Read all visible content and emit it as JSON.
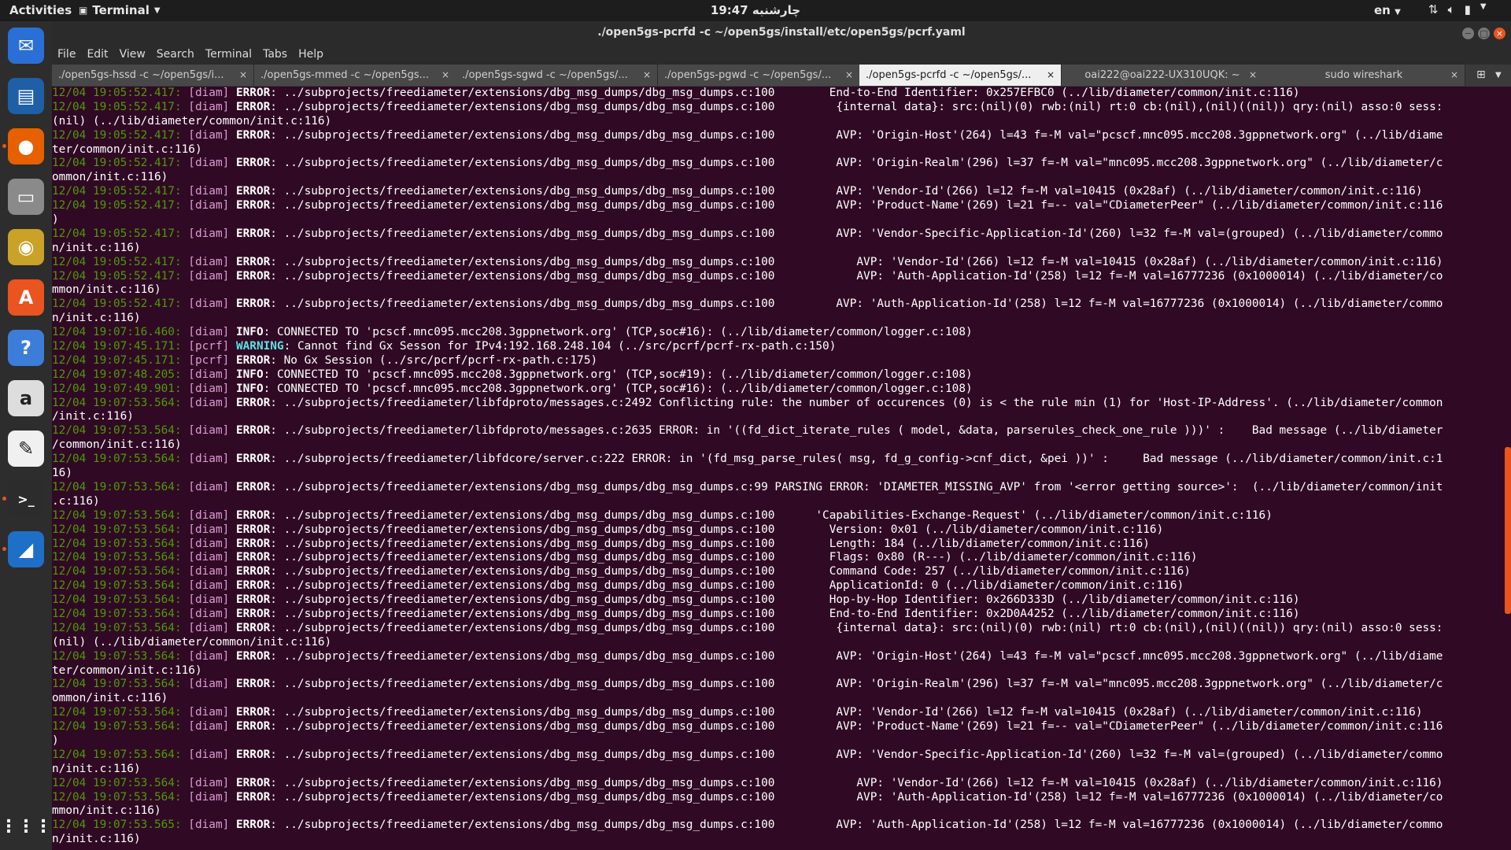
{
  "topbar": {
    "activities": "Activities",
    "app_name": "Terminal",
    "clock": "19:47 چارشنبه",
    "lang": "en"
  },
  "window": {
    "title": "./open5gs-pcrfd -c ~/open5gs/install/etc/open5gs/pcrf.yaml"
  },
  "menu": [
    "File",
    "Edit",
    "View",
    "Search",
    "Terminal",
    "Tabs",
    "Help"
  ],
  "tabs": [
    {
      "label": "./open5gs-hssd -c ~/open5gs/i...",
      "active": false
    },
    {
      "label": "./open5gs-mmed -c ~/open5gs...",
      "active": false
    },
    {
      "label": "./open5gs-sgwd -c ~/open5gs/...",
      "active": false
    },
    {
      "label": "./open5gs-pgwd -c ~/open5gs/...",
      "active": false
    },
    {
      "label": "./open5gs-pcrfd -c ~/open5gs/...",
      "active": true
    },
    {
      "label": "oai222@oai222-UX310UQK: ~",
      "active": false
    },
    {
      "label": "sudo wireshark",
      "active": false
    }
  ],
  "lines": [
    {
      "ts": "12/04 19:05:52.417:",
      "mod": "[diam]",
      "lvl": "ERROR",
      "msg": "../subprojects/freediameter/extensions/dbg_msg_dumps/dbg_msg_dumps.c:100        End-to-End Identifier: 0x257EFBC0 (../lib/diameter/common/init.c:116)"
    },
    {
      "ts": "12/04 19:05:52.417:",
      "mod": "[diam]",
      "lvl": "ERROR",
      "msg": "../subprojects/freediameter/extensions/dbg_msg_dumps/dbg_msg_dumps.c:100         {internal data}: src:(nil)(0) rwb:(nil) rt:0 cb:(nil),(nil)((nil)) qry:(nil) asso:0 sess:"
    },
    {
      "cont": "(nil) (../lib/diameter/common/init.c:116)"
    },
    {
      "ts": "12/04 19:05:52.417:",
      "mod": "[diam]",
      "lvl": "ERROR",
      "msg": "../subprojects/freediameter/extensions/dbg_msg_dumps/dbg_msg_dumps.c:100         AVP: 'Origin-Host'(264) l=43 f=-M val=\"pcscf.mnc095.mcc208.3gppnetwork.org\" (../lib/diame"
    },
    {
      "cont": "ter/common/init.c:116)"
    },
    {
      "ts": "12/04 19:05:52.417:",
      "mod": "[diam]",
      "lvl": "ERROR",
      "msg": "../subprojects/freediameter/extensions/dbg_msg_dumps/dbg_msg_dumps.c:100         AVP: 'Origin-Realm'(296) l=37 f=-M val=\"mnc095.mcc208.3gppnetwork.org\" (../lib/diameter/c"
    },
    {
      "cont": "ommon/init.c:116)"
    },
    {
      "ts": "12/04 19:05:52.417:",
      "mod": "[diam]",
      "lvl": "ERROR",
      "msg": "../subprojects/freediameter/extensions/dbg_msg_dumps/dbg_msg_dumps.c:100         AVP: 'Vendor-Id'(266) l=12 f=-M val=10415 (0x28af) (../lib/diameter/common/init.c:116)"
    },
    {
      "ts": "12/04 19:05:52.417:",
      "mod": "[diam]",
      "lvl": "ERROR",
      "msg": "../subprojects/freediameter/extensions/dbg_msg_dumps/dbg_msg_dumps.c:100         AVP: 'Product-Name'(269) l=21 f=-- val=\"CDiameterPeer\" (../lib/diameter/common/init.c:116"
    },
    {
      "cont": ")"
    },
    {
      "ts": "12/04 19:05:52.417:",
      "mod": "[diam]",
      "lvl": "ERROR",
      "msg": "../subprojects/freediameter/extensions/dbg_msg_dumps/dbg_msg_dumps.c:100         AVP: 'Vendor-Specific-Application-Id'(260) l=32 f=-M val=(grouped) (../lib/diameter/commo"
    },
    {
      "cont": "n/init.c:116)"
    },
    {
      "ts": "12/04 19:05:52.417:",
      "mod": "[diam]",
      "lvl": "ERROR",
      "msg": "../subprojects/freediameter/extensions/dbg_msg_dumps/dbg_msg_dumps.c:100            AVP: 'Vendor-Id'(266) l=12 f=-M val=10415 (0x28af) (../lib/diameter/common/init.c:116)"
    },
    {
      "ts": "12/04 19:05:52.417:",
      "mod": "[diam]",
      "lvl": "ERROR",
      "msg": "../subprojects/freediameter/extensions/dbg_msg_dumps/dbg_msg_dumps.c:100            AVP: 'Auth-Application-Id'(258) l=12 f=-M val=16777236 (0x1000014) (../lib/diameter/co"
    },
    {
      "cont": "mmon/init.c:116)"
    },
    {
      "ts": "12/04 19:05:52.417:",
      "mod": "[diam]",
      "lvl": "ERROR",
      "msg": "../subprojects/freediameter/extensions/dbg_msg_dumps/dbg_msg_dumps.c:100         AVP: 'Auth-Application-Id'(258) l=12 f=-M val=16777236 (0x1000014) (../lib/diameter/commo"
    },
    {
      "cont": "n/init.c:116)"
    },
    {
      "ts": "12/04 19:07:16.460:",
      "mod": "[diam]",
      "lvl": "INFO",
      "msg": "CONNECTED TO 'pcscf.mnc095.mcc208.3gppnetwork.org' (TCP,soc#16): (../lib/diameter/common/logger.c:108)"
    },
    {
      "ts": "12/04 19:07:45.171:",
      "mod": "[pcrf]",
      "lvl": "WARNING",
      "msg": "Cannot find Gx Sesson for IPv4:192.168.248.104 (../src/pcrf/pcrf-rx-path.c:150)"
    },
    {
      "ts": "12/04 19:07:45.171:",
      "mod": "[pcrf]",
      "lvl": "ERROR",
      "msg": "No Gx Session (../src/pcrf/pcrf-rx-path.c:175)"
    },
    {
      "ts": "12/04 19:07:48.205:",
      "mod": "[diam]",
      "lvl": "INFO",
      "msg": "CONNECTED TO 'pcscf.mnc095.mcc208.3gppnetwork.org' (TCP,soc#19): (../lib/diameter/common/logger.c:108)"
    },
    {
      "ts": "12/04 19:07:49.901:",
      "mod": "[diam]",
      "lvl": "INFO",
      "msg": "CONNECTED TO 'pcscf.mnc095.mcc208.3gppnetwork.org' (TCP,soc#16): (../lib/diameter/common/logger.c:108)"
    },
    {
      "ts": "12/04 19:07:53.564:",
      "mod": "[diam]",
      "lvl": "ERROR",
      "msg": "../subprojects/freediameter/libfdproto/messages.c:2492 Conflicting rule: the number of occurences (0) is < the rule min (1) for 'Host-IP-Address'. (../lib/diameter/common"
    },
    {
      "cont": "/init.c:116)"
    },
    {
      "ts": "12/04 19:07:53.564:",
      "mod": "[diam]",
      "lvl": "ERROR",
      "msg": "../subprojects/freediameter/libfdproto/messages.c:2635 ERROR: in '((fd_dict_iterate_rules ( model, &data, parserules_check_one_rule )))' :    Bad message (../lib/diameter"
    },
    {
      "cont": "/common/init.c:116)"
    },
    {
      "ts": "12/04 19:07:53.564:",
      "mod": "[diam]",
      "lvl": "ERROR",
      "msg": "../subprojects/freediameter/libfdcore/server.c:222 ERROR: in '(fd_msg_parse_rules( msg, fd_g_config->cnf_dict, &pei ))' :     Bad message (../lib/diameter/common/init.c:1"
    },
    {
      "cont": "16)"
    },
    {
      "ts": "12/04 19:07:53.564:",
      "mod": "[diam]",
      "lvl": "ERROR",
      "msg": "../subprojects/freediameter/extensions/dbg_msg_dumps/dbg_msg_dumps.c:99 PARSING ERROR: 'DIAMETER_MISSING_AVP' from '<error getting source>':  (../lib/diameter/common/init"
    },
    {
      "cont": ".c:116)"
    },
    {
      "ts": "12/04 19:07:53.564:",
      "mod": "[diam]",
      "lvl": "ERROR",
      "msg": "../subprojects/freediameter/extensions/dbg_msg_dumps/dbg_msg_dumps.c:100      'Capabilities-Exchange-Request' (../lib/diameter/common/init.c:116)"
    },
    {
      "ts": "12/04 19:07:53.564:",
      "mod": "[diam]",
      "lvl": "ERROR",
      "msg": "../subprojects/freediameter/extensions/dbg_msg_dumps/dbg_msg_dumps.c:100        Version: 0x01 (../lib/diameter/common/init.c:116)"
    },
    {
      "ts": "12/04 19:07:53.564:",
      "mod": "[diam]",
      "lvl": "ERROR",
      "msg": "../subprojects/freediameter/extensions/dbg_msg_dumps/dbg_msg_dumps.c:100        Length: 184 (../lib/diameter/common/init.c:116)"
    },
    {
      "ts": "12/04 19:07:53.564:",
      "mod": "[diam]",
      "lvl": "ERROR",
      "msg": "../subprojects/freediameter/extensions/dbg_msg_dumps/dbg_msg_dumps.c:100        Flags: 0x80 (R---) (../lib/diameter/common/init.c:116)"
    },
    {
      "ts": "12/04 19:07:53.564:",
      "mod": "[diam]",
      "lvl": "ERROR",
      "msg": "../subprojects/freediameter/extensions/dbg_msg_dumps/dbg_msg_dumps.c:100        Command Code: 257 (../lib/diameter/common/init.c:116)"
    },
    {
      "ts": "12/04 19:07:53.564:",
      "mod": "[diam]",
      "lvl": "ERROR",
      "msg": "../subprojects/freediameter/extensions/dbg_msg_dumps/dbg_msg_dumps.c:100        ApplicationId: 0 (../lib/diameter/common/init.c:116)"
    },
    {
      "ts": "12/04 19:07:53.564:",
      "mod": "[diam]",
      "lvl": "ERROR",
      "msg": "../subprojects/freediameter/extensions/dbg_msg_dumps/dbg_msg_dumps.c:100        Hop-by-Hop Identifier: 0x266D333D (../lib/diameter/common/init.c:116)"
    },
    {
      "ts": "12/04 19:07:53.564:",
      "mod": "[diam]",
      "lvl": "ERROR",
      "msg": "../subprojects/freediameter/extensions/dbg_msg_dumps/dbg_msg_dumps.c:100        End-to-End Identifier: 0x2D0A4252 (../lib/diameter/common/init.c:116)"
    },
    {
      "ts": "12/04 19:07:53.564:",
      "mod": "[diam]",
      "lvl": "ERROR",
      "msg": "../subprojects/freediameter/extensions/dbg_msg_dumps/dbg_msg_dumps.c:100         {internal data}: src:(nil)(0) rwb:(nil) rt:0 cb:(nil),(nil)((nil)) qry:(nil) asso:0 sess:"
    },
    {
      "cont": "(nil) (../lib/diameter/common/init.c:116)"
    },
    {
      "ts": "12/04 19:07:53.564:",
      "mod": "[diam]",
      "lvl": "ERROR",
      "msg": "../subprojects/freediameter/extensions/dbg_msg_dumps/dbg_msg_dumps.c:100         AVP: 'Origin-Host'(264) l=43 f=-M val=\"pcscf.mnc095.mcc208.3gppnetwork.org\" (../lib/diame"
    },
    {
      "cont": "ter/common/init.c:116)"
    },
    {
      "ts": "12/04 19:07:53.564:",
      "mod": "[diam]",
      "lvl": "ERROR",
      "msg": "../subprojects/freediameter/extensions/dbg_msg_dumps/dbg_msg_dumps.c:100         AVP: 'Origin-Realm'(296) l=37 f=-M val=\"mnc095.mcc208.3gppnetwork.org\" (../lib/diameter/c"
    },
    {
      "cont": "ommon/init.c:116)"
    },
    {
      "ts": "12/04 19:07:53.564:",
      "mod": "[diam]",
      "lvl": "ERROR",
      "msg": "../subprojects/freediameter/extensions/dbg_msg_dumps/dbg_msg_dumps.c:100         AVP: 'Vendor-Id'(266) l=12 f=-M val=10415 (0x28af) (../lib/diameter/common/init.c:116)"
    },
    {
      "ts": "12/04 19:07:53.564:",
      "mod": "[diam]",
      "lvl": "ERROR",
      "msg": "../subprojects/freediameter/extensions/dbg_msg_dumps/dbg_msg_dumps.c:100         AVP: 'Product-Name'(269) l=21 f=-- val=\"CDiameterPeer\" (../lib/diameter/common/init.c:116"
    },
    {
      "cont": ")"
    },
    {
      "ts": "12/04 19:07:53.564:",
      "mod": "[diam]",
      "lvl": "ERROR",
      "msg": "../subprojects/freediameter/extensions/dbg_msg_dumps/dbg_msg_dumps.c:100         AVP: 'Vendor-Specific-Application-Id'(260) l=32 f=-M val=(grouped) (../lib/diameter/commo"
    },
    {
      "cont": "n/init.c:116)"
    },
    {
      "ts": "12/04 19:07:53.564:",
      "mod": "[diam]",
      "lvl": "ERROR",
      "msg": "../subprojects/freediameter/extensions/dbg_msg_dumps/dbg_msg_dumps.c:100            AVP: 'Vendor-Id'(266) l=12 f=-M val=10415 (0x28af) (../lib/diameter/common/init.c:116)"
    },
    {
      "ts": "12/04 19:07:53.564:",
      "mod": "[diam]",
      "lvl": "ERROR",
      "msg": "../subprojects/freediameter/extensions/dbg_msg_dumps/dbg_msg_dumps.c:100            AVP: 'Auth-Application-Id'(258) l=12 f=-M val=16777236 (0x1000014) (../lib/diameter/co"
    },
    {
      "cont": "mmon/init.c:116)"
    },
    {
      "ts": "12/04 19:07:53.565:",
      "mod": "[diam]",
      "lvl": "ERROR",
      "msg": "../subprojects/freediameter/extensions/dbg_msg_dumps/dbg_msg_dumps.c:100         AVP: 'Auth-Application-Id'(258) l=12 f=-M val=16777236 (0x1000014) (../lib/diameter/commo"
    },
    {
      "cont": "n/init.c:116)"
    }
  ],
  "dock": [
    {
      "name": "thunderbird-icon",
      "color": "#2a6fd6",
      "glyph": "✉"
    },
    {
      "name": "libreoffice-writer-icon",
      "color": "#1f5fa8",
      "glyph": "▤"
    },
    {
      "name": "firefox-icon",
      "color": "#e66000",
      "glyph": "●"
    },
    {
      "name": "files-icon",
      "color": "#8a8a8a",
      "glyph": "▭"
    },
    {
      "name": "rhythmbox-icon",
      "color": "#c9a227",
      "glyph": "◉"
    },
    {
      "name": "software-center-icon",
      "color": "#e95420",
      "glyph": "A"
    },
    {
      "name": "help-icon",
      "color": "#3c7dd9",
      "glyph": "?"
    },
    {
      "name": "amazon-icon",
      "color": "#dddddd",
      "glyph": "a"
    },
    {
      "name": "text-editor-icon",
      "color": "#f0f0f0",
      "glyph": "✎"
    },
    {
      "name": "terminal-icon",
      "color": "#2c2c2c",
      "glyph": ">_"
    },
    {
      "name": "wireshark-icon",
      "color": "#1e6fc8",
      "glyph": "◢"
    }
  ],
  "colors": {
    "accent": "#e95420",
    "term_bg": "#300a24",
    "ts": "#4e9a06",
    "mod": "#dd9bd6",
    "warning": "#5ee1e6"
  }
}
